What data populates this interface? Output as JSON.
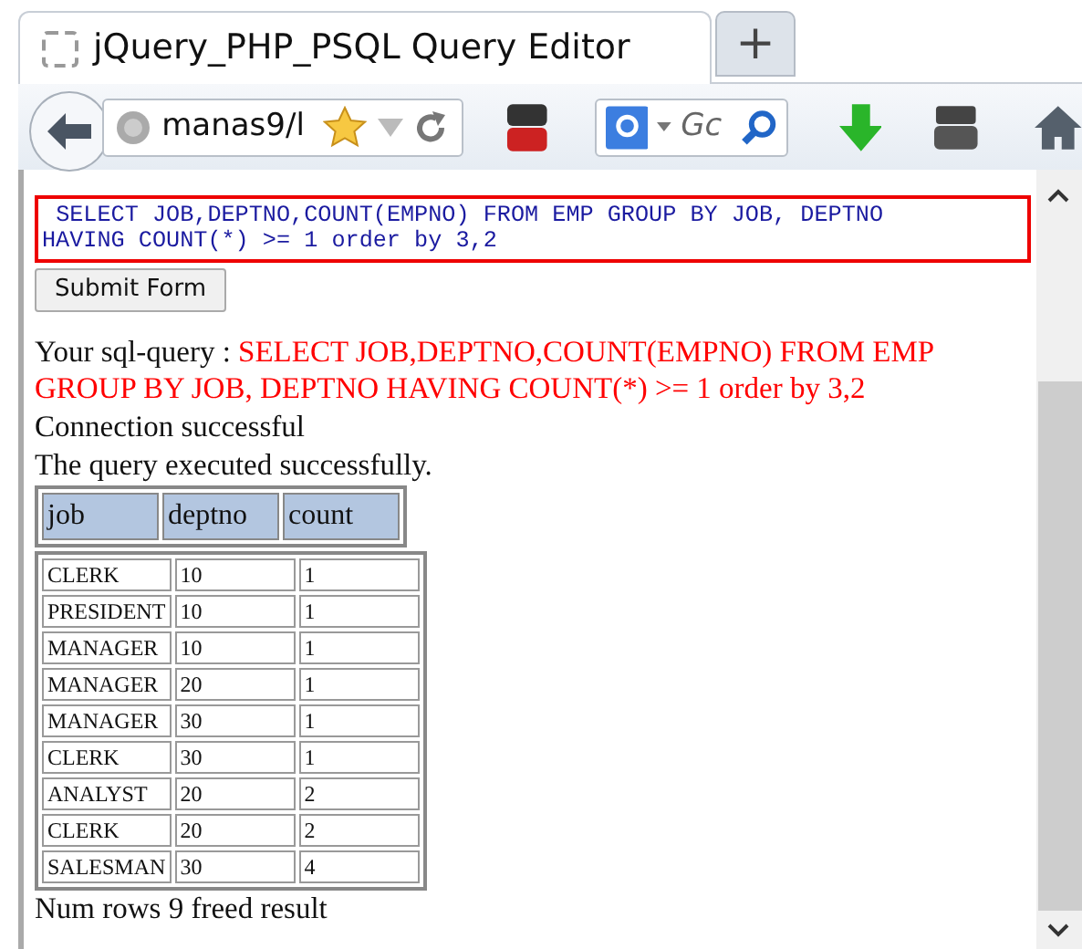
{
  "browser": {
    "tab_title": "jQuery_PHP_PSQL Query Editor",
    "new_tab": "+",
    "address": "manas9/l",
    "search_placeholder": "Gc"
  },
  "query_box": {
    "value": " SELECT JOB,DEPTNO,COUNT(EMPNO) FROM EMP GROUP BY JOB, DEPTNO HAVING COUNT(*) >= 1 order by 3,2"
  },
  "submit_button": "Submit Form",
  "query_label": "Your sql-query : ",
  "query_text": "SELECT JOB,DEPTNO,COUNT(EMPNO) FROM EMP GROUP BY JOB, DEPTNO HAVING COUNT(*) >= 1 order by 3,2",
  "messages": [
    "Connection successful",
    "The query executed successfully."
  ],
  "table": {
    "columns": [
      "job",
      "deptno",
      "count"
    ],
    "rows": [
      [
        "CLERK",
        "10",
        "1"
      ],
      [
        "PRESIDENT",
        "10",
        "1"
      ],
      [
        "MANAGER",
        "10",
        "1"
      ],
      [
        "MANAGER",
        "20",
        "1"
      ],
      [
        "MANAGER",
        "30",
        "1"
      ],
      [
        "CLERK",
        "30",
        "1"
      ],
      [
        "ANALYST",
        "20",
        "2"
      ],
      [
        "CLERK",
        "20",
        "2"
      ],
      [
        "SALESMAN",
        "30",
        "4"
      ]
    ]
  },
  "footer": "Num rows 9 freed result"
}
